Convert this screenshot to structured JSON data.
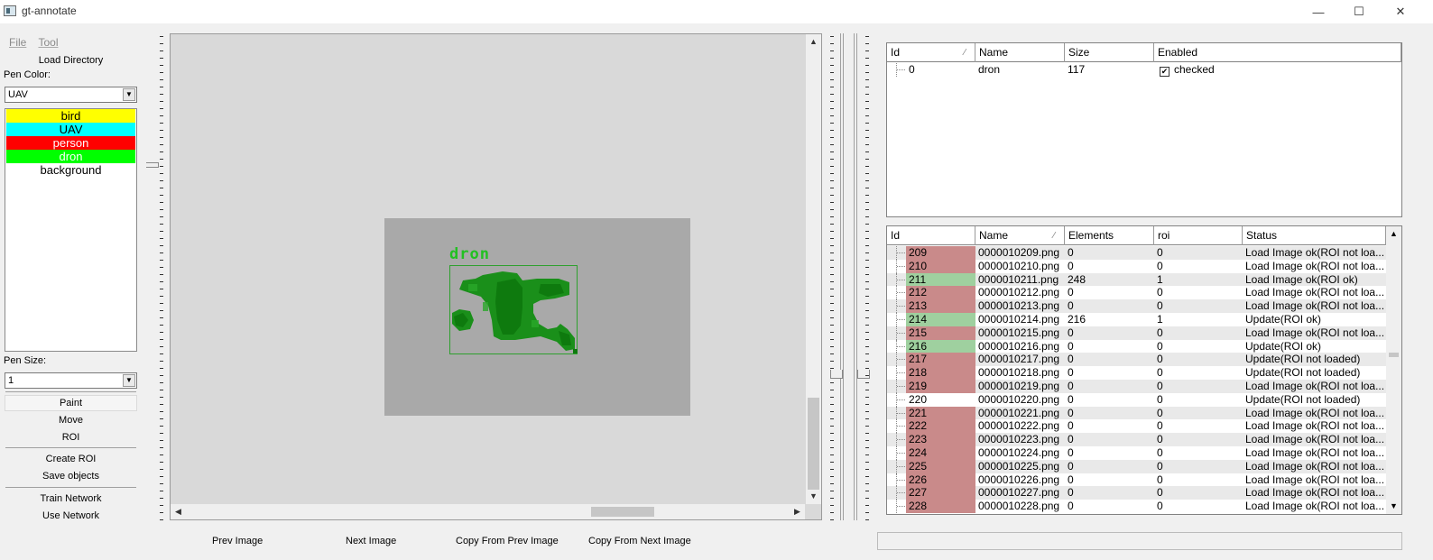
{
  "window": {
    "title": "gt-annotate",
    "min": "—",
    "max": "☐",
    "close": "✕"
  },
  "menu": {
    "file": "File",
    "tool": "Tool"
  },
  "left": {
    "load_directory": "Load Directory",
    "pen_color_label": "Pen Color:",
    "pen_color_value": "UAV",
    "classes": [
      {
        "label": "bird",
        "color": "#ffff00",
        "text_color": "#000000"
      },
      {
        "label": "UAV",
        "color": "#00ffff",
        "text_color": "#000000"
      },
      {
        "label": "person",
        "color": "#ff0000",
        "text_color": "#ffffff"
      },
      {
        "label": "dron",
        "color": "#00ff00",
        "text_color": "#ffffff"
      },
      {
        "label": "background",
        "color": "#ffffff",
        "text_color": "#000000"
      }
    ],
    "pen_size_label": "Pen Size:",
    "pen_size_value": "1",
    "paint": "Paint",
    "move": "Move",
    "roi": "ROI",
    "create_roi": "Create ROI",
    "save_objects": "Save objects",
    "train_network": "Train Network",
    "use_network": "Use Network"
  },
  "canvas": {
    "annotation_label": "dron",
    "annotation_color": "#22c022"
  },
  "bottom": {
    "prev_image": "Prev Image",
    "next_image": "Next Image",
    "copy_from_prev": "Copy From Prev Image",
    "copy_from_next": "Copy From Next Image"
  },
  "objects_table": {
    "headers": [
      "Id",
      "Name",
      "Size",
      "Enabled"
    ],
    "rows": [
      {
        "id": "0",
        "name": "dron",
        "size": "117",
        "enabled": "checked"
      }
    ]
  },
  "files_table": {
    "headers": [
      "Id",
      "Name",
      "Elements",
      "roi",
      "Status"
    ],
    "rows": [
      {
        "id": "209",
        "name": "0000010209.png",
        "elements": "0",
        "roi": "0",
        "status": "Load Image ok(ROI not loa...",
        "state": "bad"
      },
      {
        "id": "210",
        "name": "0000010210.png",
        "elements": "0",
        "roi": "0",
        "status": "Load Image ok(ROI not loa...",
        "state": "bad"
      },
      {
        "id": "211",
        "name": "0000010211.png",
        "elements": "248",
        "roi": "1",
        "status": "Load Image ok(ROI ok)",
        "state": "ok"
      },
      {
        "id": "212",
        "name": "0000010212.png",
        "elements": "0",
        "roi": "0",
        "status": "Load Image ok(ROI not loa...",
        "state": "bad"
      },
      {
        "id": "213",
        "name": "0000010213.png",
        "elements": "0",
        "roi": "0",
        "status": "Load Image ok(ROI not loa...",
        "state": "bad"
      },
      {
        "id": "214",
        "name": "0000010214.png",
        "elements": "216",
        "roi": "1",
        "status": "Update(ROI ok)",
        "state": "ok"
      },
      {
        "id": "215",
        "name": "0000010215.png",
        "elements": "0",
        "roi": "0",
        "status": "Load Image ok(ROI not loa...",
        "state": "bad"
      },
      {
        "id": "216",
        "name": "0000010216.png",
        "elements": "0",
        "roi": "0",
        "status": "Update(ROI ok)",
        "state": "ok"
      },
      {
        "id": "217",
        "name": "0000010217.png",
        "elements": "0",
        "roi": "0",
        "status": "Update(ROI not loaded)",
        "state": "bad"
      },
      {
        "id": "218",
        "name": "0000010218.png",
        "elements": "0",
        "roi": "0",
        "status": "Update(ROI not loaded)",
        "state": "bad"
      },
      {
        "id": "219",
        "name": "0000010219.png",
        "elements": "0",
        "roi": "0",
        "status": "Load Image ok(ROI not loa...",
        "state": "bad"
      },
      {
        "id": "220",
        "name": "0000010220.png",
        "elements": "0",
        "roi": "0",
        "status": "Update(ROI not loaded)",
        "state": "none"
      },
      {
        "id": "221",
        "name": "0000010221.png",
        "elements": "0",
        "roi": "0",
        "status": "Load Image ok(ROI not loa...",
        "state": "bad"
      },
      {
        "id": "222",
        "name": "0000010222.png",
        "elements": "0",
        "roi": "0",
        "status": "Load Image ok(ROI not loa...",
        "state": "bad"
      },
      {
        "id": "223",
        "name": "0000010223.png",
        "elements": "0",
        "roi": "0",
        "status": "Load Image ok(ROI not loa...",
        "state": "bad"
      },
      {
        "id": "224",
        "name": "0000010224.png",
        "elements": "0",
        "roi": "0",
        "status": "Load Image ok(ROI not loa...",
        "state": "bad"
      },
      {
        "id": "225",
        "name": "0000010225.png",
        "elements": "0",
        "roi": "0",
        "status": "Load Image ok(ROI not loa...",
        "state": "bad"
      },
      {
        "id": "226",
        "name": "0000010226.png",
        "elements": "0",
        "roi": "0",
        "status": "Load Image ok(ROI not loa...",
        "state": "bad"
      },
      {
        "id": "227",
        "name": "0000010227.png",
        "elements": "0",
        "roi": "0",
        "status": "Load Image ok(ROI not loa...",
        "state": "bad"
      },
      {
        "id": "228",
        "name": "0000010228.png",
        "elements": "0",
        "roi": "0",
        "status": "Load Image ok(ROI not loa...",
        "state": "bad"
      }
    ],
    "state_colors": {
      "ok": "#9fd09f",
      "bad": "#c98a8a",
      "none": "#ffffff"
    }
  }
}
